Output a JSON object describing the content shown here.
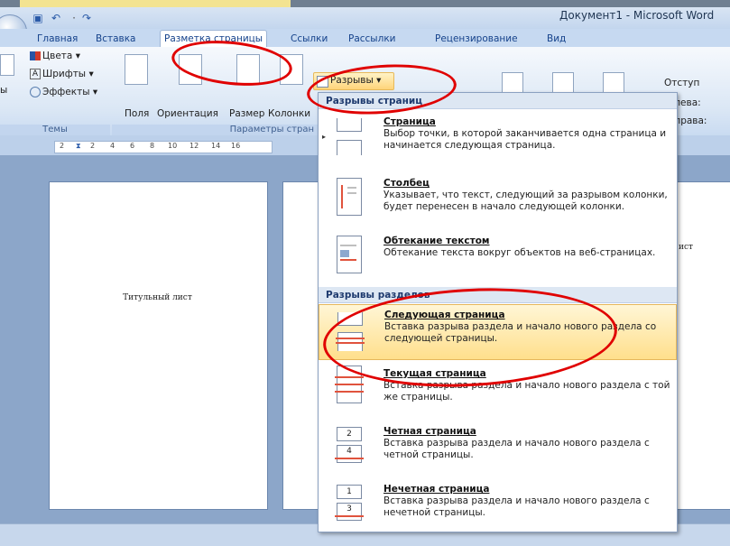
{
  "window": {
    "title": "Документ1 - Microsoft Word"
  },
  "tabs": [
    "Главная",
    "Вставка",
    "Разметка страницы",
    "Ссылки",
    "Рассылки",
    "Рецензирование",
    "Вид"
  ],
  "ribbon": {
    "themes_group": {
      "items": [
        "Цвета",
        "Шрифты",
        "Эффекты"
      ],
      "left_cut": "ы",
      "label": "Темы"
    },
    "page_setup_group": {
      "buttons": [
        "Поля",
        "Ориентация",
        "Размер",
        "Колонки"
      ],
      "label": "Параметры стран"
    },
    "breaks_button": "Разрывы",
    "indent": {
      "title": "Отступ",
      "left": "Слева:",
      "right": "Справа:"
    }
  },
  "ruler": {
    "ticks": [
      "2",
      "2",
      "4",
      "6",
      "8",
      "10",
      "12",
      "14",
      "16"
    ]
  },
  "document": {
    "page1_text": "Титульный лист",
    "page2_text": "ист"
  },
  "menu": {
    "page_breaks_header": "Разрывы страниц",
    "section_breaks_header": "Разрывы разделов",
    "items": [
      {
        "title": "Страница",
        "desc": "Выбор точки, в которой заканчивается одна страница и начинается следующая страница."
      },
      {
        "title": "Столбец",
        "desc": "Указывает, что текст, следующий за разрывом колонки, будет перенесен в начало следующей колонки."
      },
      {
        "title": "Обтекание текстом",
        "desc": "Обтекание текста вокруг объектов на веб-страницах."
      },
      {
        "title": "Следующая страница",
        "desc": "Вставка разрыва раздела и начало нового раздела со следующей страницы."
      },
      {
        "title": "Текущая страница",
        "desc": "Вставка разрыва раздела и начало нового раздела с той же страницы."
      },
      {
        "title": "Четная страница",
        "desc": "Вставка разрыва раздела и начало нового раздела с четной страницы."
      },
      {
        "title": "Нечетная страница",
        "desc": "Вставка разрыва раздела и начало нового раздела с нечетной страницы."
      }
    ],
    "icon_numbers": {
      "even_top": "2",
      "even_bottom": "4",
      "odd_top": "1",
      "odd_bottom": "3"
    }
  },
  "colors": {
    "highlight": "#ffdf8c",
    "annotation_red": "#e00000",
    "ribbon_blue": "#c6d9f1"
  }
}
